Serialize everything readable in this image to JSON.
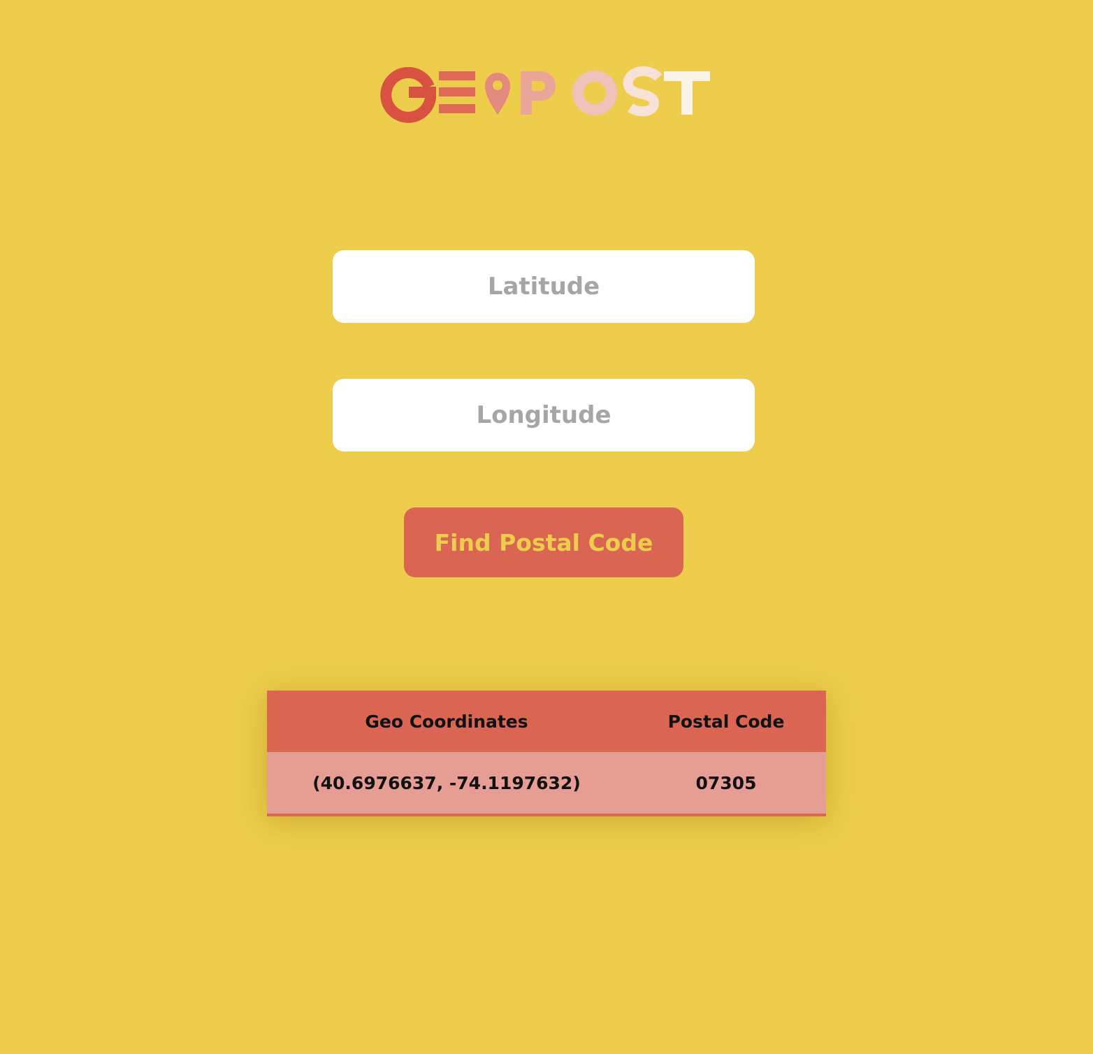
{
  "app": {
    "logo_text": "GEOPOST",
    "logo_colors": [
      "#D95141",
      "#E06A5A",
      "#E28A7D",
      "#E8A598",
      "#EFC3BA",
      "#F6E2D6",
      "#FBF4E8"
    ]
  },
  "form": {
    "latitude": {
      "placeholder": "Latitude",
      "value": ""
    },
    "longitude": {
      "placeholder": "Longitude",
      "value": ""
    },
    "submit_label": "Find Postal Code"
  },
  "results": {
    "columns": [
      "Geo Coordinates",
      "Postal Code"
    ],
    "rows": [
      {
        "coordinates": "(40.6976637, -74.1197632)",
        "postal_code": "07305"
      }
    ]
  },
  "colors": {
    "background": "#EDCD4B",
    "accent": "#D96552",
    "row_fill": "#E69D93",
    "input_fill": "#FFFFFF",
    "placeholder": "#A6A6A6"
  }
}
